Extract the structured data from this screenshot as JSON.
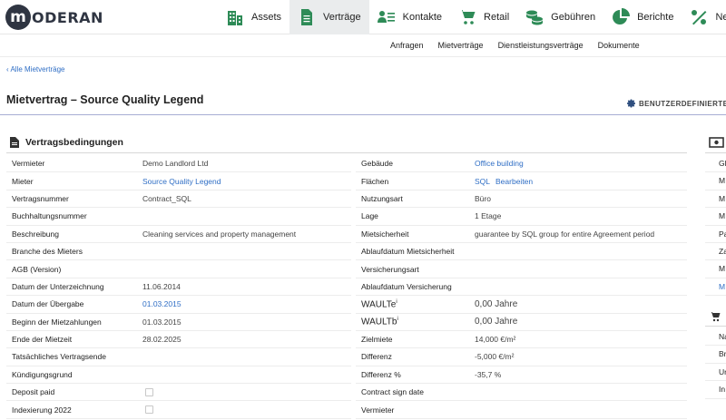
{
  "brand": {
    "logo_letter": "m",
    "logo_text": "ODERAN"
  },
  "nav": {
    "items": [
      {
        "label": "Assets",
        "icon": "buildings-icon"
      },
      {
        "label": "Verträge",
        "icon": "document-icon",
        "active": true
      },
      {
        "label": "Kontakte",
        "icon": "contacts-icon"
      },
      {
        "label": "Retail",
        "icon": "cart-icon"
      },
      {
        "label": "Gebühren",
        "icon": "coins-icon"
      },
      {
        "label": "Berichte",
        "icon": "pie-chart-icon"
      },
      {
        "label": "Neben",
        "icon": "percent-leaf-icon"
      }
    ]
  },
  "subnav": [
    "Anfragen",
    "Mietverträge",
    "Dienstleistungsverträge",
    "Dokumente"
  ],
  "back_link": "‹ Alle Mietverträge",
  "page_title": "Mietvertrag – Source Quality Legend",
  "custom_button": "BENUTZERDEFINIERTE",
  "section": {
    "title": "Vertragsbedingungen"
  },
  "left_rows": [
    {
      "label": "Vermieter",
      "value": "Demo Landlord Ltd",
      "link": false
    },
    {
      "label": "Mieter",
      "value": "Source Quality Legend",
      "link": true
    },
    {
      "label": "Vertragsnummer",
      "value": "Contract_SQL",
      "link": false
    },
    {
      "label": "Buchhaltungsnummer",
      "value": "",
      "link": false
    },
    {
      "label": "Beschreibung",
      "value": "Cleaning services and property management",
      "link": false
    },
    {
      "label": "Branche des Mieters",
      "value": "",
      "link": false
    },
    {
      "label": "AGB (Version)",
      "value": "",
      "link": false
    },
    {
      "label": "Datum der Unterzeichnung",
      "value": "11.06.2014",
      "link": false
    },
    {
      "label": "Datum der Übergabe",
      "value": "01.03.2015",
      "link": true
    },
    {
      "label": "Beginn der Mietzahlungen",
      "value": "01.03.2015",
      "link": false
    },
    {
      "label": "Ende der Mietzeit",
      "value": "28.02.2025",
      "link": false
    },
    {
      "label": "Tatsächliches Vertragsende",
      "value": "",
      "link": false
    },
    {
      "label": "Kündigungsgrund",
      "value": "",
      "link": false
    },
    {
      "label": "Deposit paid",
      "value": "",
      "checkbox": true
    },
    {
      "label": "Indexierung 2022",
      "value": "",
      "checkbox": true
    }
  ],
  "right_rows": [
    {
      "label": "Gebäude",
      "value": "Office building",
      "link": true
    },
    {
      "label": "Flächen",
      "value": "SQL",
      "value2": "Bearbeiten",
      "link": true
    },
    {
      "label": "Nutzungsart",
      "value": "Büro"
    },
    {
      "label": "Lage",
      "value": "1 Etage"
    },
    {
      "label": "Mietsicherheit",
      "value": "guarantee by SQL group for entire Agreement period"
    },
    {
      "label": "Ablaufdatum Mietsicherheit",
      "value": ""
    },
    {
      "label": "Versicherungsart",
      "value": ""
    },
    {
      "label": "Ablaufdatum Versicherung",
      "value": ""
    },
    {
      "label": "WAULTe",
      "sup": "i",
      "value": "0,00 Jahre",
      "big": true
    },
    {
      "label": "WAULTb",
      "sup": "i",
      "value": "0,00 Jahre",
      "big": true
    },
    {
      "label": "Zielmiete",
      "value": "14,000 €/m²"
    },
    {
      "label": "Differenz",
      "value": "-5,000 €/m²"
    },
    {
      "label": "Differenz %",
      "value": "-35,7 %"
    },
    {
      "label": "Contract sign date",
      "value": ""
    },
    {
      "label": "Vermieter",
      "value": ""
    }
  ],
  "side_rows": [
    {
      "text": "Gl",
      "link": false
    },
    {
      "text": "M",
      "link": false
    },
    {
      "text": "M",
      "link": false
    },
    {
      "text": "M",
      "link": false
    },
    {
      "text": "Pa",
      "link": false
    },
    {
      "text": "Za",
      "link": false
    },
    {
      "text": "M",
      "link": false
    },
    {
      "text": "M",
      "link": true
    }
  ],
  "side_rows2": [
    "Na",
    "Br",
    "Ur",
    "In"
  ],
  "colors": {
    "accent": "#2f6ec5",
    "nav_active": "#eaeced",
    "title_rule": "#a7aed4",
    "icon_green": "#2e8b57"
  }
}
